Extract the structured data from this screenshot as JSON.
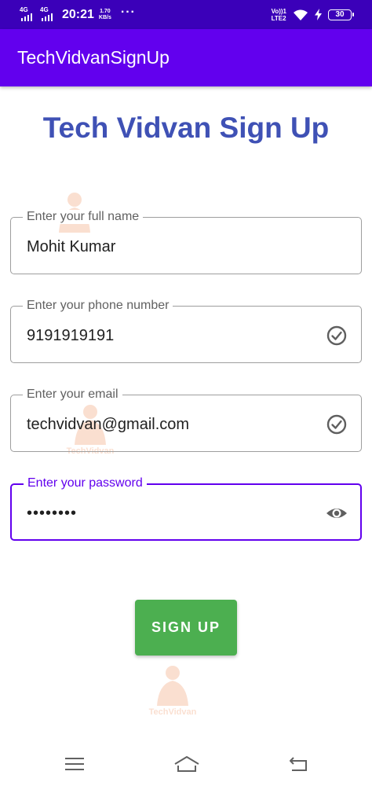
{
  "status_bar": {
    "signal1_label": "4G",
    "signal2_label": "4G",
    "time": "20:21",
    "speed_value": "1.70",
    "speed_unit": "KB/s",
    "more": "···",
    "volte_line1": "Vo))1",
    "volte_line2": "LTE2",
    "battery_level": "30"
  },
  "app_bar": {
    "title": "TechVidvanSignUp"
  },
  "heading": "Tech Vidvan Sign Up",
  "form": {
    "full_name": {
      "label": "Enter your full name",
      "value": "Mohit Kumar"
    },
    "phone": {
      "label": "Enter your phone number",
      "value": "9191919191",
      "icon": "check-circle-icon"
    },
    "email": {
      "label": "Enter your email",
      "value": "techvidvan@gmail.com",
      "icon": "check-circle-icon"
    },
    "password": {
      "label": "Enter your password",
      "value": "••••••••",
      "icon": "eye-icon"
    }
  },
  "signup_button": "SIGN UP",
  "watermark_text": "TechVidvan",
  "colors": {
    "status_bar": "#3b00b9",
    "app_bar": "#6200ee",
    "heading": "#3f51b5",
    "button": "#4caf50",
    "focus": "#6200ee"
  }
}
